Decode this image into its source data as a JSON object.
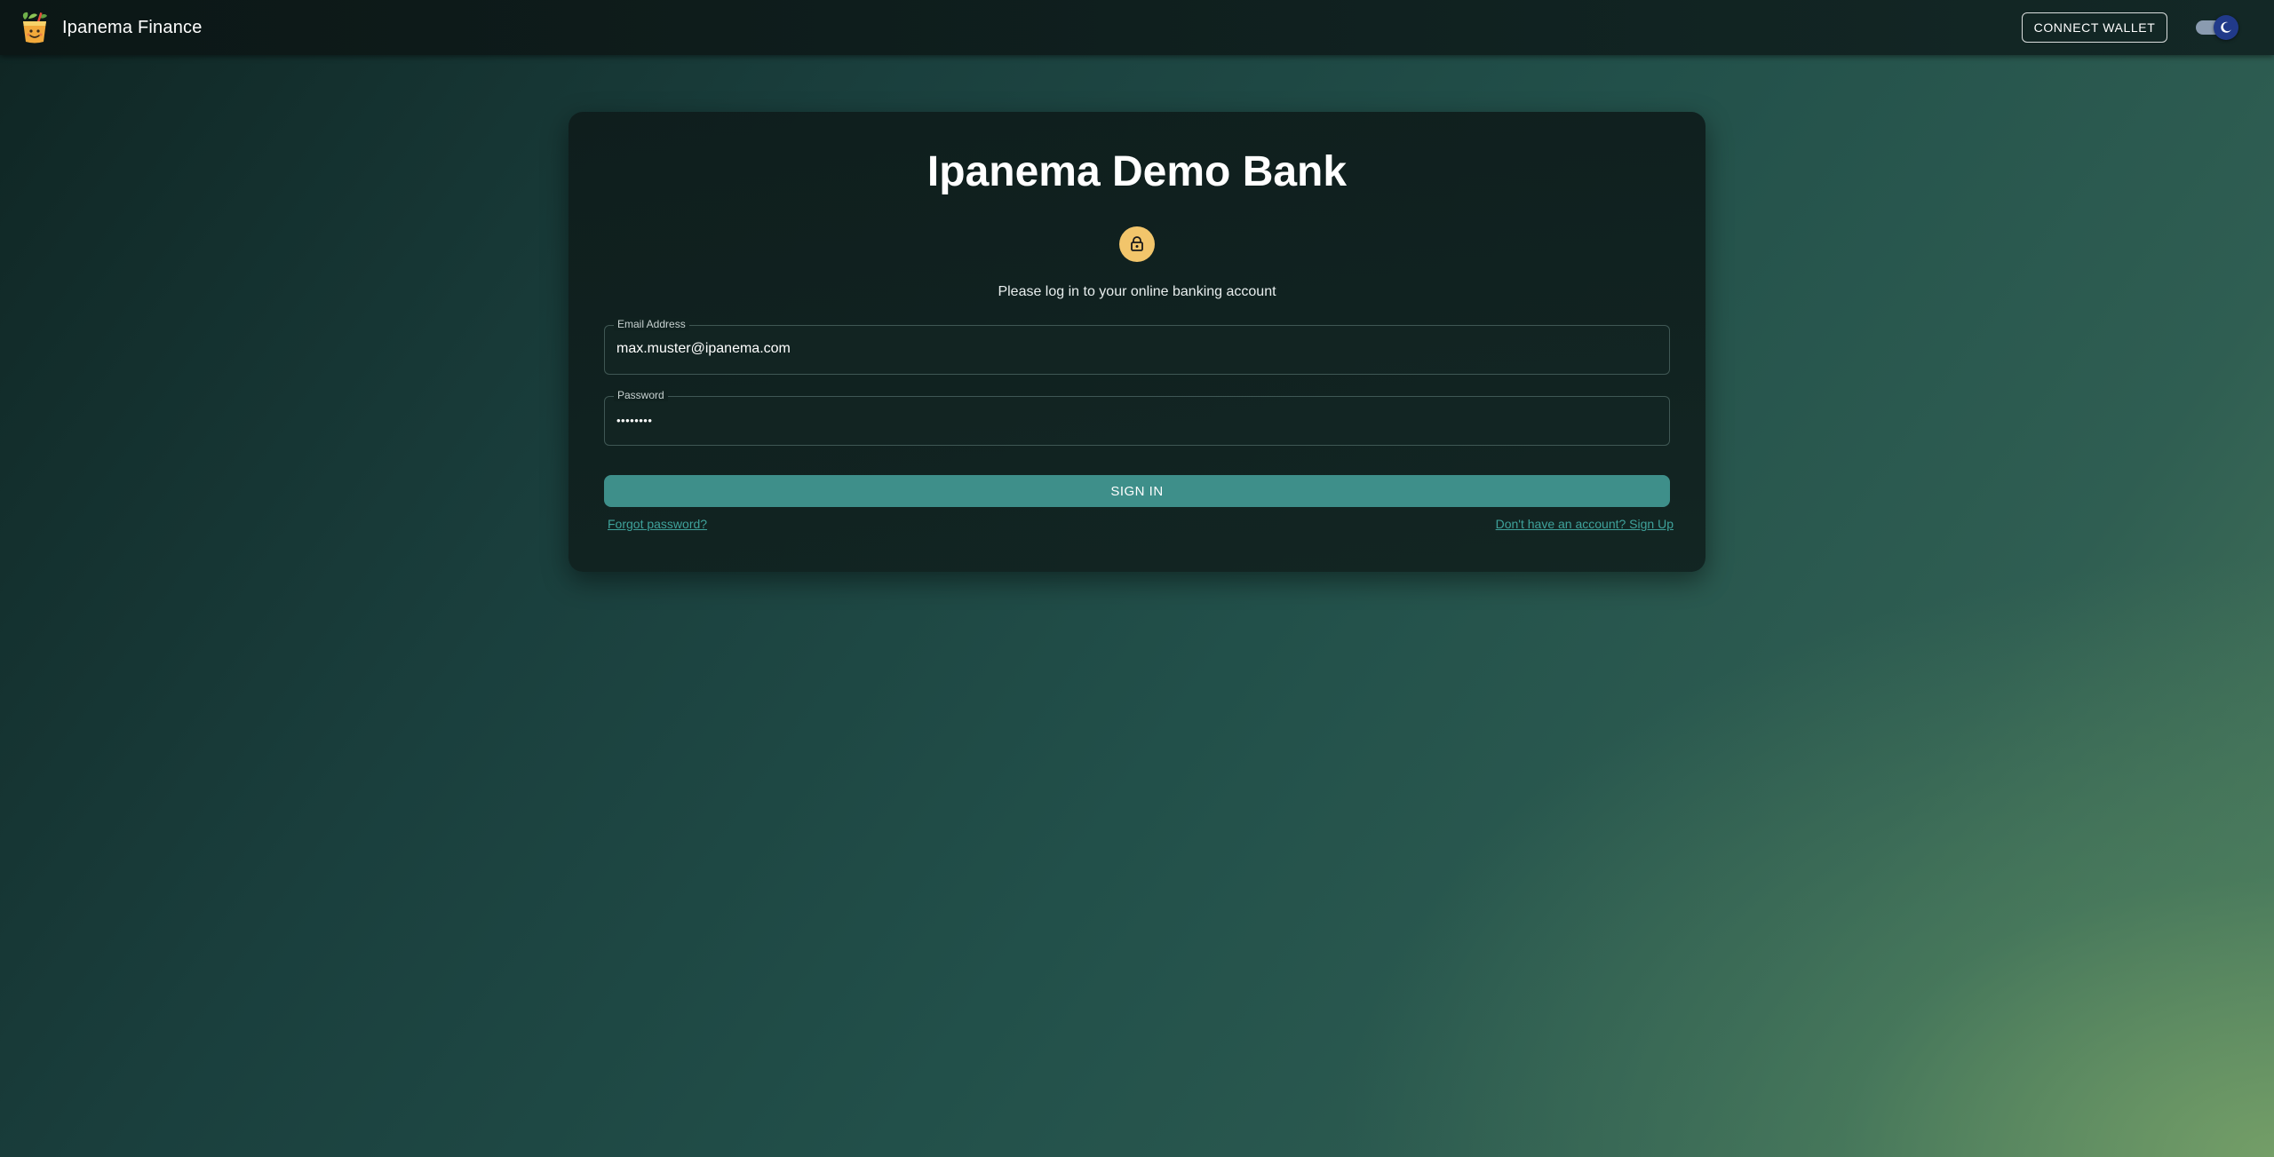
{
  "header": {
    "brand_name": "Ipanema Finance",
    "connect_wallet_label": "CONNECT WALLET",
    "logo_icon": "cocktail-logo-icon",
    "theme_toggle_icon": "moon-icon",
    "theme_mode": "dark"
  },
  "login": {
    "title": "Ipanema Demo Bank",
    "lock_icon": "lock-icon",
    "subtitle": "Please log in to your online banking account",
    "email": {
      "label": "Email Address",
      "value": "max.muster@ipanema.com"
    },
    "password": {
      "label": "Password",
      "value": "••••••••"
    },
    "sign_in_label": "SIGN IN",
    "forgot_password_label": "Forgot password?",
    "sign_up_label": "Don't have an account? Sign Up"
  },
  "colors": {
    "accent": "#3e8f8a",
    "link": "#3fa29b",
    "lock_avatar": "#f2c56b",
    "toggle_thumb": "#213a8a"
  }
}
